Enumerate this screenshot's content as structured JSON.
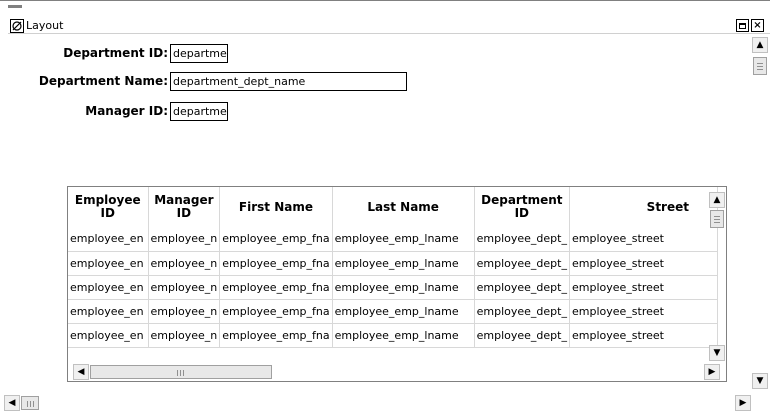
{
  "window": {
    "title": "Layout",
    "icon": "layout-window-icon",
    "maximize_icon": "maximize-icon",
    "close_icon": "close-icon",
    "close_glyph": "×"
  },
  "form": {
    "fields": [
      {
        "label": "Department ID:",
        "value": "departme"
      },
      {
        "label": "Department Name:",
        "value": "department_dept_name"
      },
      {
        "label": "Manager ID:",
        "value": "departme"
      }
    ]
  },
  "grid": {
    "columns": [
      "Employee ID",
      "Manager ID",
      "First Name",
      "Last Name",
      "Department ID",
      "Street"
    ],
    "rows": [
      [
        "employee_en",
        "employee_n",
        "employee_emp_fna",
        "employee_emp_lname",
        "employee_dept_",
        "employee_street"
      ],
      [
        "employee_en",
        "employee_n",
        "employee_emp_fna",
        "employee_emp_lname",
        "employee_dept_",
        "employee_street"
      ],
      [
        "employee_en",
        "employee_n",
        "employee_emp_fna",
        "employee_emp_lname",
        "employee_dept_",
        "employee_street"
      ],
      [
        "employee_en",
        "employee_n",
        "employee_emp_fna",
        "employee_emp_lname",
        "employee_dept_",
        "employee_street"
      ],
      [
        "employee_en",
        "employee_n",
        "employee_emp_fna",
        "employee_emp_lname",
        "employee_dept_",
        "employee_street"
      ]
    ]
  },
  "scroll": {
    "up": "▲",
    "down": "▼",
    "left": "◀",
    "right": "▶"
  }
}
